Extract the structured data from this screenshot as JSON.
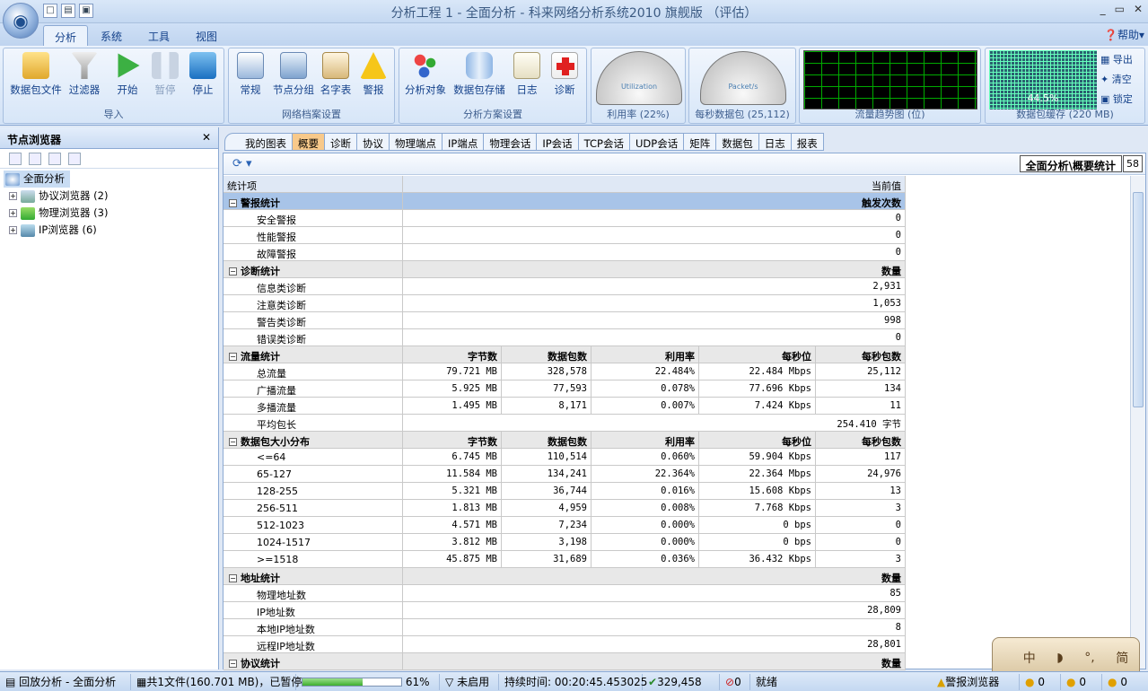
{
  "window": {
    "title": "分析工程 1 - 全面分析 - 科来网络分析系统2010 旗舰版 （评估）",
    "minimize": "_",
    "maximize": "▭",
    "close": "✕"
  },
  "ribbon_tabs": [
    "分析",
    "系统",
    "工具",
    "视图"
  ],
  "help_label": "帮助",
  "groups": {
    "import": {
      "label": "导入",
      "buttons": [
        "数据包文件",
        "过滤器",
        "开始",
        "暂停",
        "停止"
      ]
    },
    "profile": {
      "label": "网络档案设置",
      "buttons": [
        "常规",
        "节点分组",
        "名字表",
        "警报"
      ]
    },
    "scheme": {
      "label": "分析方案设置",
      "buttons": [
        "分析对象",
        "数据包存储",
        "日志",
        "诊断"
      ]
    },
    "util_gauge": {
      "label": "利用率 (22%)",
      "gauge_text": "Utilization",
      "value_percent": 22
    },
    "pps_gauge": {
      "label": "每秒数据包 (25,112)",
      "gauge_text": "Packet/s"
    },
    "trend": {
      "label": "流量趋势图 (位)"
    },
    "buffer": {
      "label": "数据包缓存 (220 MB)",
      "percent": "44.5%",
      "side_buttons": [
        "导出",
        "清空",
        "锁定"
      ]
    }
  },
  "left_panel": {
    "title": "节点浏览器",
    "close": "✕",
    "tree": {
      "root": "全面分析",
      "children": [
        "协议浏览器 (2)",
        "物理浏览器 (3)",
        "IP浏览器 (6)"
      ]
    }
  },
  "doc_tabs": [
    "我的图表",
    "概要",
    "诊断",
    "协议",
    "物理端点",
    "IP端点",
    "物理会话",
    "IP会话",
    "TCP会话",
    "UDP会话",
    "矩阵",
    "数据包",
    "日志",
    "报表"
  ],
  "active_doc_tab": "概要",
  "breadcrumb": "全面分析\\概要统计",
  "breadcrumb_count": "58",
  "table": {
    "header": [
      "统计项",
      "当前值"
    ],
    "alarm": {
      "title": "警报统计",
      "col": "触发次数",
      "rows": [
        [
          "安全警报",
          "0"
        ],
        [
          "性能警报",
          "0"
        ],
        [
          "故障警报",
          "0"
        ]
      ]
    },
    "diag": {
      "title": "诊断统计",
      "col": "数量",
      "rows": [
        [
          "信息类诊断",
          "2,931"
        ],
        [
          "注意类诊断",
          "1,053"
        ],
        [
          "警告类诊断",
          "998"
        ],
        [
          "错误类诊断",
          "0"
        ]
      ]
    },
    "traffic": {
      "title": "流量统计",
      "cols": [
        "字节数",
        "数据包数",
        "利用率",
        "每秒位",
        "每秒包数"
      ],
      "rows": [
        [
          "总流量",
          "79.721 MB",
          "328,578",
          "22.484%",
          "22.484 Mbps",
          "25,112"
        ],
        [
          "广播流量",
          "5.925 MB",
          "77,593",
          "0.078%",
          "77.696 Kbps",
          "134"
        ],
        [
          "多播流量",
          "1.495 MB",
          "8,171",
          "0.007%",
          "7.424 Kbps",
          "11"
        ]
      ],
      "avg_label": "平均包长",
      "avg_value": "254.410 字节"
    },
    "size": {
      "title": "数据包大小分布",
      "cols": [
        "字节数",
        "数据包数",
        "利用率",
        "每秒位",
        "每秒包数"
      ],
      "rows": [
        [
          "<=64",
          "6.745 MB",
          "110,514",
          "0.060%",
          "59.904 Kbps",
          "117"
        ],
        [
          "65-127",
          "11.584 MB",
          "134,241",
          "22.364%",
          "22.364 Mbps",
          "24,976"
        ],
        [
          "128-255",
          "5.321 MB",
          "36,744",
          "0.016%",
          "15.608 Kbps",
          "13"
        ],
        [
          "256-511",
          "1.813 MB",
          "4,959",
          "0.008%",
          "7.768 Kbps",
          "3"
        ],
        [
          "512-1023",
          "4.571 MB",
          "7,234",
          "0.000%",
          "0 bps",
          "0"
        ],
        [
          "1024-1517",
          "3.812 MB",
          "3,198",
          "0.000%",
          "0 bps",
          "0"
        ],
        [
          ">=1518",
          "45.875 MB",
          "31,689",
          "0.036%",
          "36.432 Kbps",
          "3"
        ]
      ]
    },
    "addr": {
      "title": "地址统计",
      "col": "数量",
      "rows": [
        [
          "物理地址数",
          "85"
        ],
        [
          "IP地址数",
          "28,809"
        ],
        [
          "本地IP地址数",
          "8"
        ],
        [
          "远程IP地址数",
          "28,801"
        ]
      ]
    },
    "proto": {
      "title": "协议统计",
      "col": "数量"
    }
  },
  "ime": [
    "中",
    "◗",
    "°,",
    "简"
  ],
  "status": {
    "mode": "回放分析 - 全面分析",
    "files": "共1文件(160.701 MB)，已暂停",
    "progress": "61%",
    "progress_value": 61,
    "filter": "未启用",
    "duration": "持续时间: 00:20:45.453025",
    "packets": "329,458",
    "dropped": "0",
    "state": "就绪",
    "alarm_browser": "警报浏览器",
    "c1": "0",
    "c2": "0",
    "c3": "0"
  },
  "colors": {
    "accent": "#15428b",
    "active_tab": "#f8c98a",
    "section_blue": "#a8c4e8"
  }
}
